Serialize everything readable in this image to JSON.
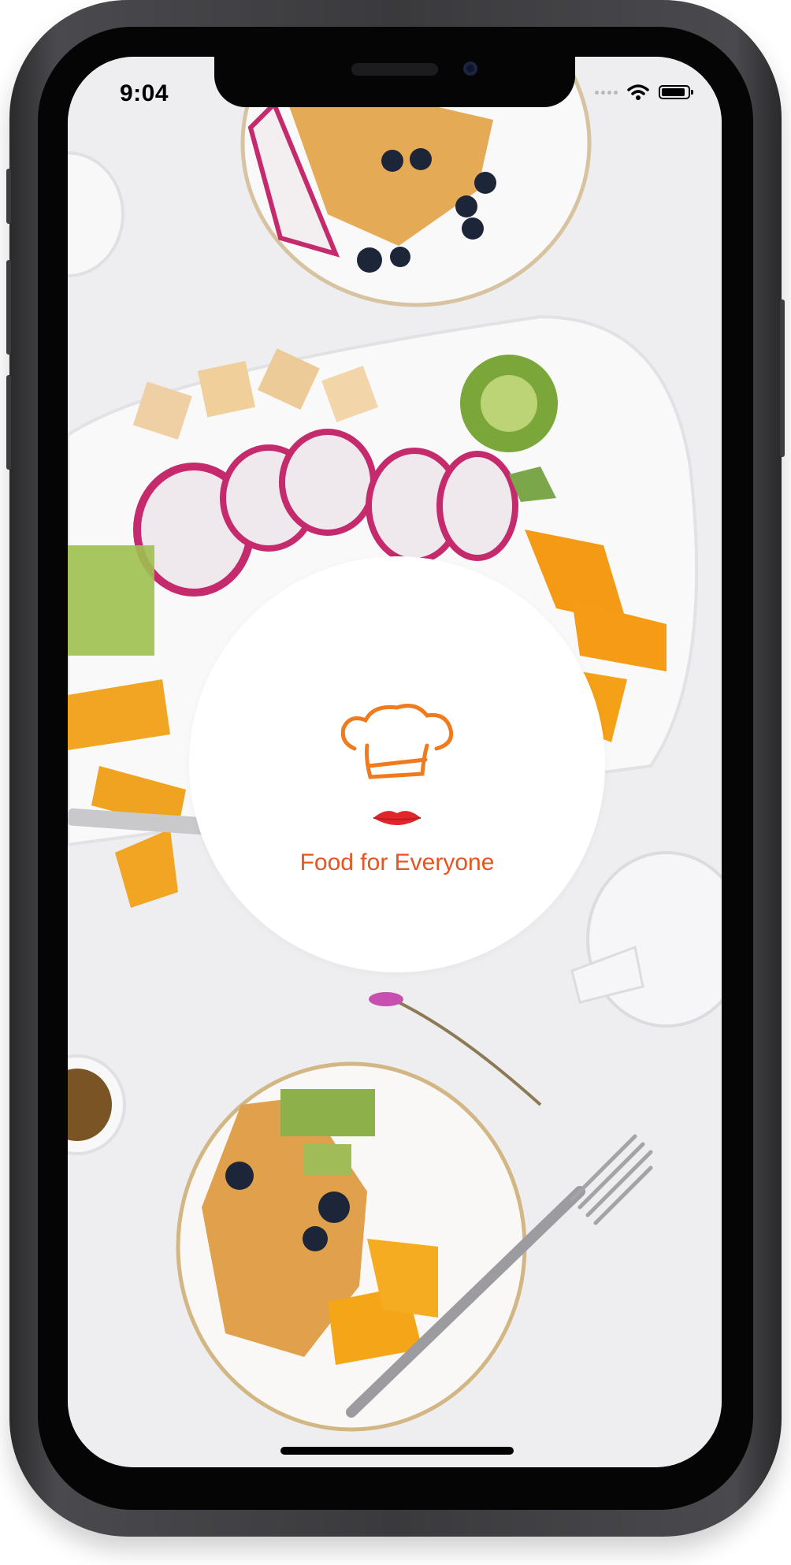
{
  "status_bar": {
    "time": "9:04",
    "signal_icon": "cellular-signal-icon",
    "wifi_icon": "wifi-icon",
    "battery_icon": "battery-icon",
    "battery_level": 0.9
  },
  "splash": {
    "logo_icon": "chef-hat-lips-logo-icon",
    "tagline": "Food for Everyone"
  },
  "colors": {
    "brand": "#e8531e",
    "logo_orange": "#f07a1e",
    "logo_red": "#e0262a",
    "screen_background": "#f1f1f3"
  }
}
